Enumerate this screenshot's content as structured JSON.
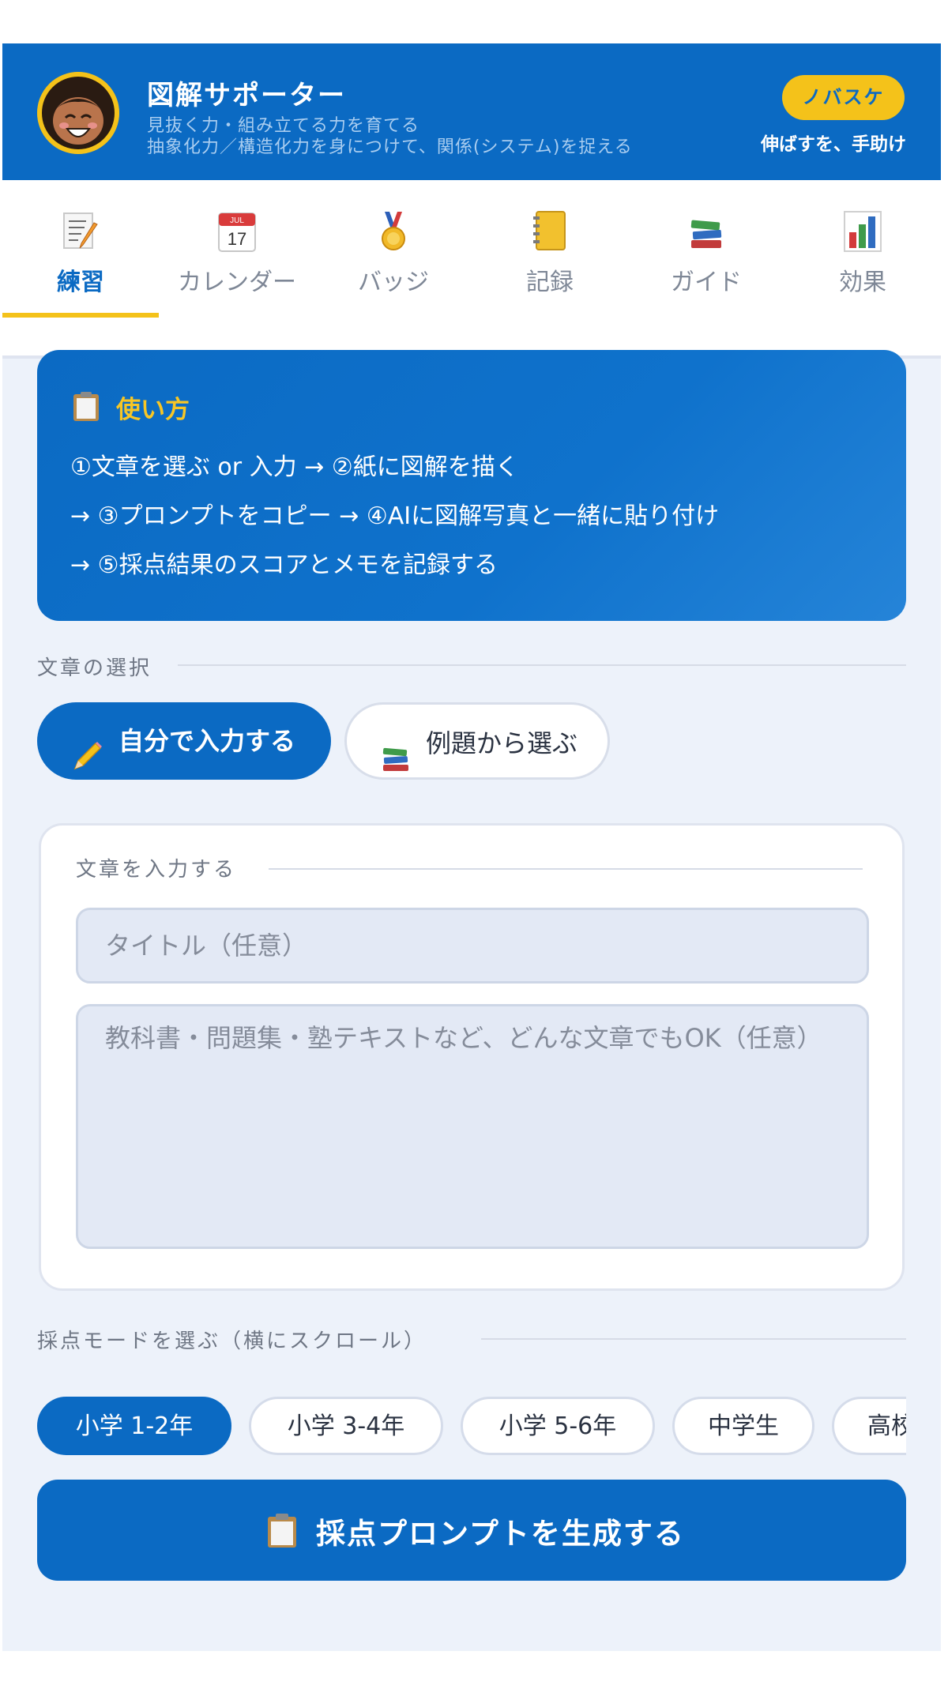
{
  "header": {
    "title": "図解サポーター",
    "subtitle_1": "見抜く力・組み立てる力を育てる",
    "subtitle_2": "抽象化力／構造化力を身につけて、関係(システム)を捉える",
    "brand_badge": "ノバスケ",
    "brand_tagline": "伸ばすを、手助け"
  },
  "tabs": [
    {
      "label": "練習",
      "icon": "memo-icon",
      "active": true
    },
    {
      "label": "カレンダー",
      "icon": "calendar-icon",
      "calendar_text": "JUL",
      "calendar_day": "17"
    },
    {
      "label": "バッジ",
      "icon": "medal-icon"
    },
    {
      "label": "記録",
      "icon": "notebook-icon"
    },
    {
      "label": "ガイド",
      "icon": "books-icon"
    },
    {
      "label": "効果",
      "icon": "bar-chart-icon"
    }
  ],
  "howto": {
    "title": "使い方",
    "line_1": "①文章を選ぶ or 入力 → ②紙に図解を描く",
    "line_2": "→ ③プロンプトをコピー → ④AIに図解写真と一緒に貼り付け",
    "line_3": "→ ⑤採点結果のスコアとメモを記録する"
  },
  "source_section": {
    "heading": "文章の選択",
    "self_input": "自分で入力する",
    "from_examples": "例題から選ぶ"
  },
  "input_card": {
    "heading": "文章を入力する",
    "title_placeholder": "タイトル（任意）",
    "body_placeholder": "教科書・問題集・塾テキストなど、どんな文章でもOK（任意）"
  },
  "mode_section": {
    "heading": "採点モードを選ぶ（横にスクロール）",
    "modes": [
      "小学 1-2年",
      "小学 3-4年",
      "小学 5-6年",
      "中学生",
      "高校生"
    ],
    "selected": "小学 1-2年"
  },
  "generate_button": "採点プロンプトを生成する",
  "colors": {
    "primary": "#0b6ac3",
    "accent": "#f4c21a",
    "background": "#edf2fa"
  }
}
